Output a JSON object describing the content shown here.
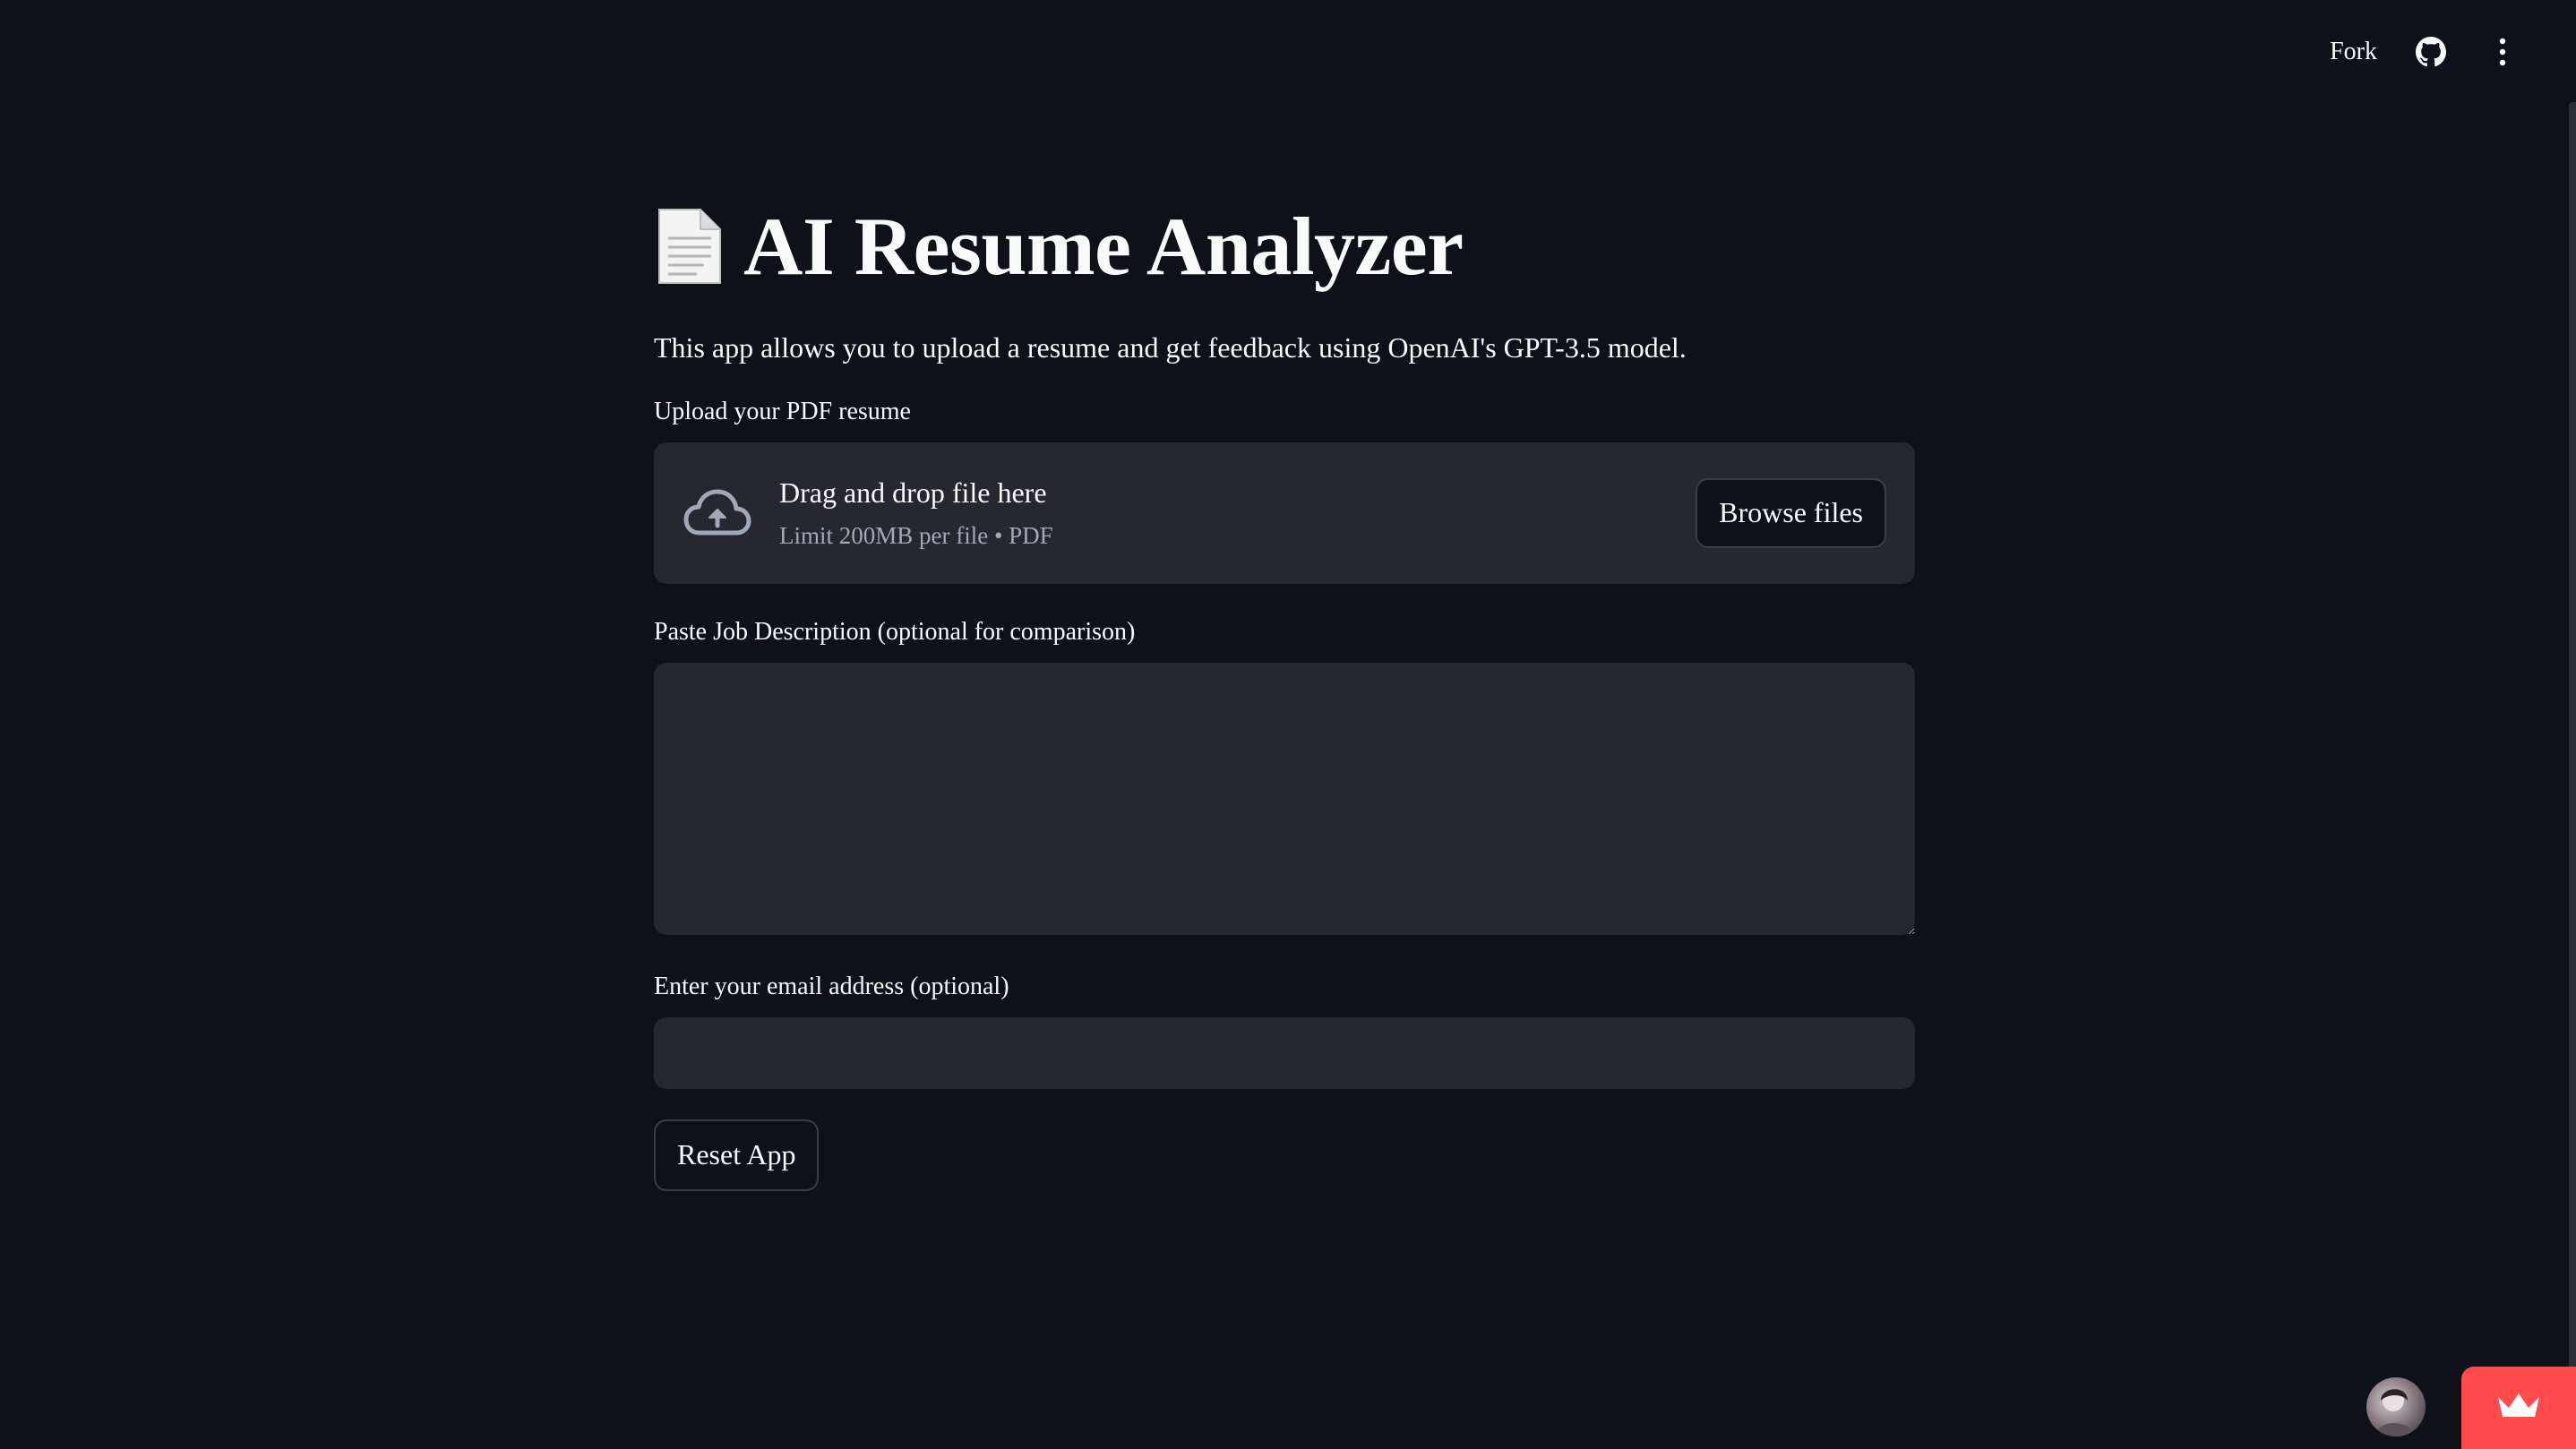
{
  "toolbar": {
    "fork_label": "Fork",
    "github_icon": "github-icon",
    "menu_icon": "kebab-menu-icon"
  },
  "header": {
    "title_icon": "page-document-emoji",
    "title": "AI Resume Analyzer",
    "intro": "This app allows you to upload a resume and get feedback using OpenAI's GPT-3.5 model."
  },
  "upload": {
    "label": "Upload your PDF resume",
    "drop_text": "Drag and drop file here",
    "limit_text": "Limit 200MB per file • PDF",
    "browse_label": "Browse files",
    "icon": "cloud-upload-icon"
  },
  "job_description": {
    "label": "Paste Job Description (optional for comparison)",
    "value": "",
    "placeholder": ""
  },
  "email": {
    "label": "Enter your email address (optional)",
    "value": "",
    "placeholder": ""
  },
  "actions": {
    "reset_label": "Reset App"
  },
  "footer": {
    "avatar_icon": "user-avatar",
    "crown_icon": "crown-icon"
  },
  "colors": {
    "background": "#0e1117",
    "widget": "#262730",
    "text": "#fafafa",
    "muted": "#a3a8b8",
    "accent": "#ff4b4b"
  }
}
